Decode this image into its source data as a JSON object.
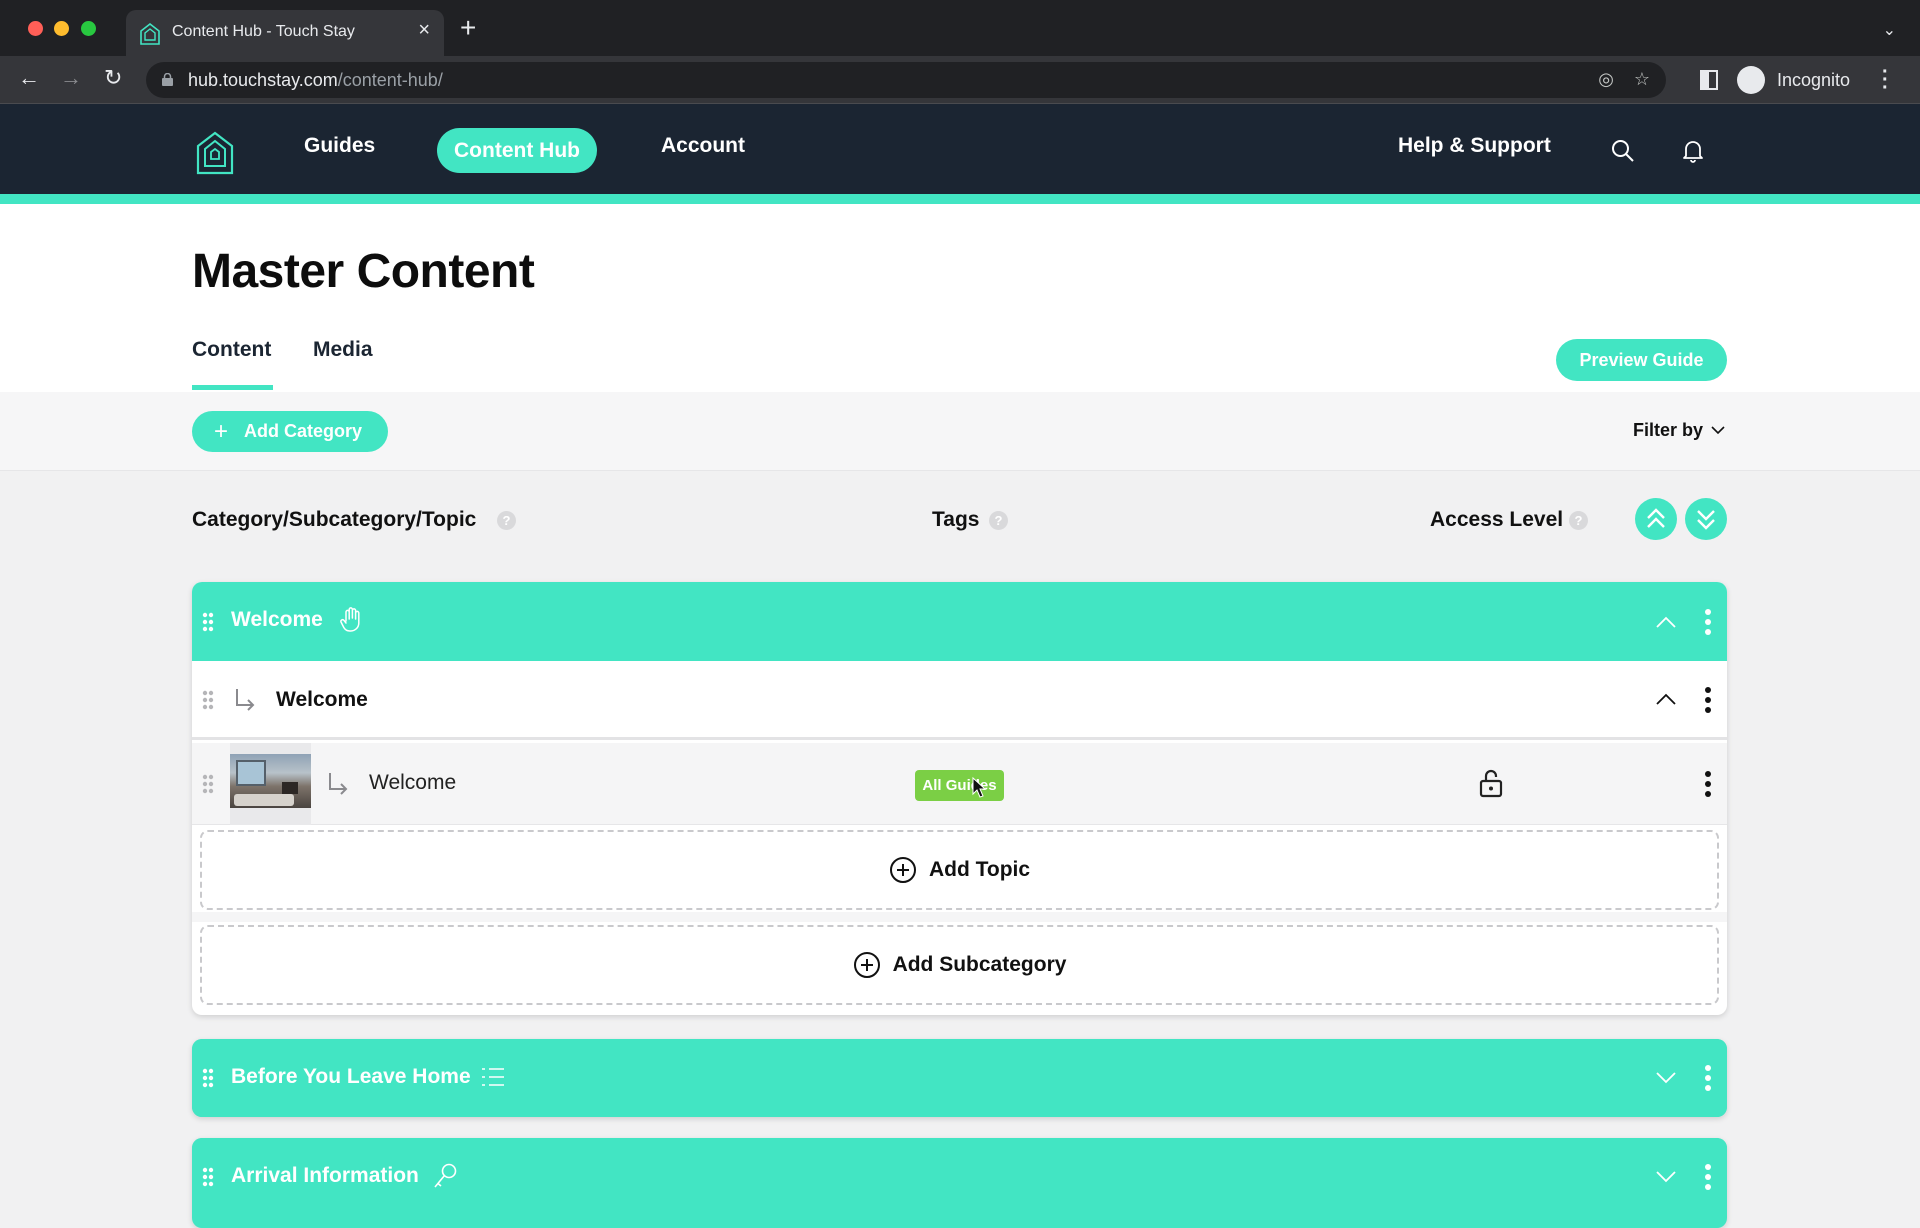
{
  "browser": {
    "tab_title": "Content Hub - Touch Stay",
    "url_host": "hub.touchstay.com",
    "url_path": "/content-hub/",
    "profile_label": "Incognito"
  },
  "header": {
    "nav": [
      {
        "label": "Guides",
        "active": false
      },
      {
        "label": "Content Hub",
        "active": true
      },
      {
        "label": "Account",
        "active": false
      }
    ],
    "help_label": "Help & Support",
    "brand_color": "#42e5c3",
    "header_bg": "#1b2532"
  },
  "page": {
    "title": "Master Content",
    "tabs": [
      {
        "label": "Content",
        "active": true
      },
      {
        "label": "Media",
        "active": false
      }
    ],
    "preview_button": "Preview Guide",
    "add_category_button": "Add Category",
    "filter_label": "Filter by"
  },
  "columns": {
    "category": "Category/Subcategory/Topic",
    "tags": "Tags",
    "access": "Access Level",
    "help_glyph": "?"
  },
  "categories": [
    {
      "title": "Welcome",
      "icon": "hand-icon",
      "expanded": true,
      "subcategories": [
        {
          "title": "Welcome",
          "expanded": true,
          "topics": [
            {
              "title": "Welcome",
              "tag": "All Guides",
              "tag_color": "#7bcf45",
              "access": "unlocked"
            }
          ]
        }
      ],
      "add_topic_label": "Add Topic",
      "add_subcategory_label": "Add Subcategory"
    },
    {
      "title": "Before You Leave Home",
      "icon": "list-icon",
      "expanded": false
    },
    {
      "title": "Arrival Information",
      "icon": "key-icon",
      "expanded": false
    }
  ]
}
